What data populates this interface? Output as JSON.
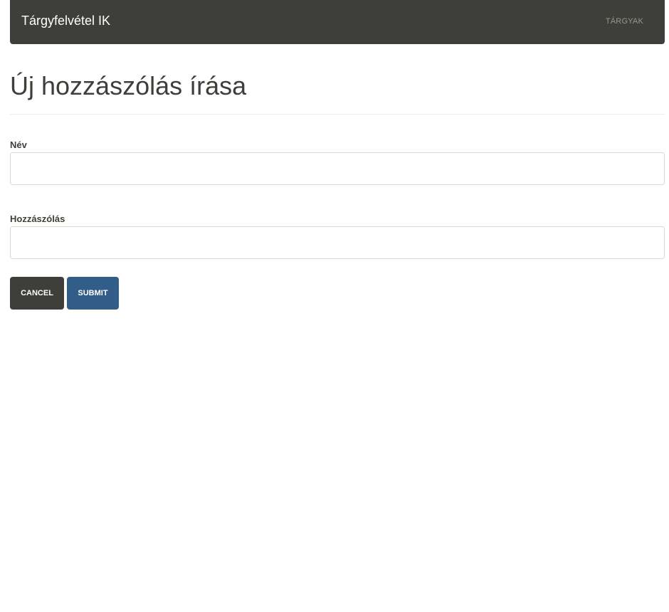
{
  "navbar": {
    "brand": "Tárgyfelvétel IK",
    "links": [
      {
        "label": "TÁRGYAK"
      }
    ]
  },
  "page": {
    "title": "Új hozzászólás írása"
  },
  "form": {
    "name_label": "Név",
    "name_value": "",
    "comment_label": "Hozzászólás",
    "comment_value": "",
    "cancel_label": "CANCEL",
    "submit_label": "SUBMIT"
  },
  "colors": {
    "navbar_bg": "#3e3f3a",
    "primary": "#325d88",
    "text": "#3e3f3a",
    "border": "#dfd7ca"
  }
}
